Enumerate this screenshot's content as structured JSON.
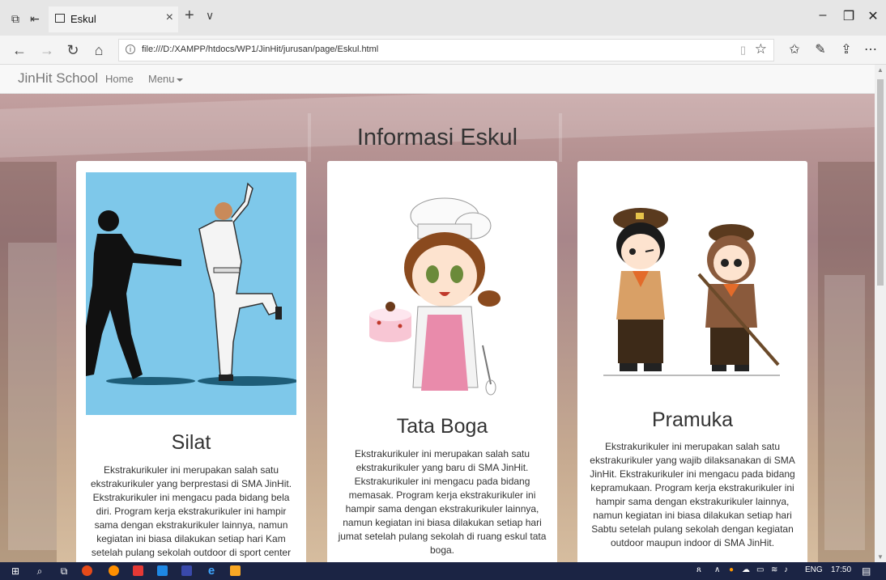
{
  "browser": {
    "tab_title": "Eskul",
    "url": "file:///D:/XAMPP/htdocs/WP1/JinHit/jurusan/page/Eskul.html",
    "new_tab_symbol": "+",
    "tab_list_symbol": "∨"
  },
  "navbar": {
    "brand": "JinHit School",
    "home": "Home",
    "menu": "Menu"
  },
  "page": {
    "title": "Informasi Eskul"
  },
  "cards": [
    {
      "title": "Silat",
      "text": "Ekstrakurikuler ini merupakan salah satu ekstrakurikuler yang berprestasi di SMA JinHit. Ekstrakurikuler ini mengacu pada bidang bela diri. Program kerja ekstrakurikuler ini hampir sama dengan ekstrakurikuler lainnya, namun kegiatan ini biasa dilakukan setiap hari Kam setelah pulang sekolah outdoor di sport center SMA JinHit."
    },
    {
      "title": "Tata Boga",
      "text": "Ekstrakurikuler ini merupakan salah satu ekstrakurikuler yang baru di SMA JinHit. Ekstrakurikuler ini mengacu pada bidang memasak. Program kerja ekstrakurikuler ini hampir sama dengan ekstrakurikuler lainnya, namun kegiatan ini biasa dilakukan setiap hari jumat setelah pulang sekolah di ruang eskul tata boga."
    },
    {
      "title": "Pramuka",
      "text": "Ekstrakurikuler ini merupakan salah satu ekstrakurikuler yang wajib dilaksanakan di SMA JinHit. Ekstrakurikuler ini mengacu pada bidang kepramukaan. Program kerja ekstrakurikuler ini hampir sama dengan ekstrakurikuler lainnya, namun kegiatan ini biasa dilakukan setiap hari Sabtu setelah pulang sekolah dengan kegiatan outdoor maupun indoor di SMA JinHit."
    }
  ],
  "taskbar": {
    "language": "ENG",
    "time": "17:50"
  },
  "colors": {
    "taskbar": "#1b2444",
    "silat_sky": "#7ec8ea"
  }
}
